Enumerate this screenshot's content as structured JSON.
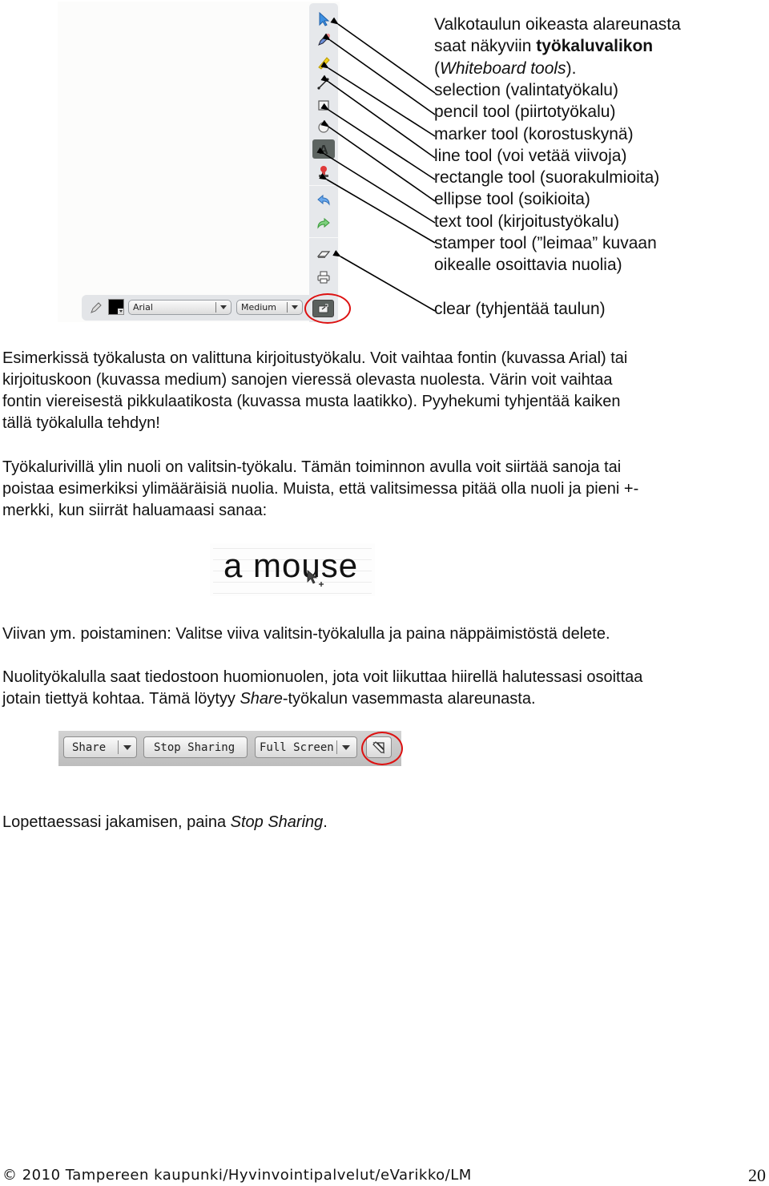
{
  "whiteboard": {
    "vertical_tools": [
      {
        "name": "selection",
        "icon": "cursor-arrow-icon"
      },
      {
        "name": "pencil",
        "icon": "pencil-icon"
      },
      {
        "name": "marker",
        "icon": "marker-icon"
      },
      {
        "name": "line",
        "icon": "line-icon"
      },
      {
        "name": "rectangle",
        "icon": "rectangle-icon"
      },
      {
        "name": "ellipse",
        "icon": "ellipse-icon"
      },
      {
        "name": "text",
        "icon": "text-icon"
      },
      {
        "name": "stamper",
        "icon": "stamp-icon"
      },
      {
        "name": "undo",
        "icon": "undo-icon"
      },
      {
        "name": "redo",
        "icon": "redo-icon"
      },
      {
        "name": "eraser",
        "icon": "eraser-icon"
      },
      {
        "name": "print",
        "icon": "printer-icon"
      }
    ],
    "font_select": "Arial",
    "size_select": "Medium",
    "color_swatch": "#000000",
    "highlight_color": "#d11111"
  },
  "callouts": {
    "intro_line1": "Valkotaulun oikeasta alareunasta",
    "intro_line2_prefix": "saat näkyviin ",
    "intro_line2_bold": "työkaluvalikon",
    "intro_line3_open": "(",
    "intro_line3_italic": "Whiteboard tools",
    "intro_line3_close": ").",
    "items": [
      "selection (valintatyökalu)",
      "pencil tool (piirtotyökalu)",
      "marker tool (korostuskynä)",
      "line tool (voi vetää viivoja)",
      "rectangle tool (suorakulmioita)",
      "ellipse tool (soikioita)",
      "text tool (kirjoitustyökalu)",
      "stamper tool (”leimaa” kuvaan",
      "oikealle osoittavia nuolia)"
    ],
    "clear": "clear (tyhjentää taulun)"
  },
  "paragraph1": [
    "Esimerkissä työkalusta on valittuna kirjoitustyökalu. Voit vaihtaa fontin (kuvassa Arial) tai",
    "kirjoituskoon (kuvassa medium) sanojen vieressä olevasta nuolesta. Värin voit vaihtaa",
    "fontin viereisestä pikkulaatikosta (kuvassa musta laatikko). Pyyhekumi tyhjentää kaiken",
    "tällä työkalulla tehdyn!"
  ],
  "paragraph2": [
    "Työkalurivillä ylin nuoli on valitsin-työkalu. Tämän toiminnon avulla voit siirtää sanoja tai",
    "poistaa esimerkiksi ylimääräisiä nuolia. Muista, että valitsimessa pitää olla nuoli ja pieni +-",
    "merkki, kun siirrät haluamaasi sanaa:"
  ],
  "mouse_example": "a mouse",
  "paragraph3": "Viivan ym. poistaminen: Valitse viiva valitsin-työkalulla ja paina näppäimistöstä delete.",
  "paragraph4": {
    "line1": "Nuolityökalulla saat tiedostoon huomionuolen, jota voit liikuttaa hiirellä halutessasi osoittaa",
    "line2_prefix": "jotain tiettyä kohtaa. Tämä löytyy ",
    "line2_italic": "Share",
    "line2_suffix": "-työkalun vasemmasta alareunasta."
  },
  "share_toolbar": {
    "share": "Share",
    "stop_sharing": "Stop Sharing",
    "full_screen": "Full Screen"
  },
  "paragraph5": {
    "prefix": "Lopettaessasi jakamisen, paina ",
    "italic": "Stop Sharing",
    "suffix": "."
  },
  "footer": {
    "copyright": "© 2010 Tampereen kaupunki/Hyvinvointipalvelut/eVarikko/LM",
    "page_number": "20"
  }
}
